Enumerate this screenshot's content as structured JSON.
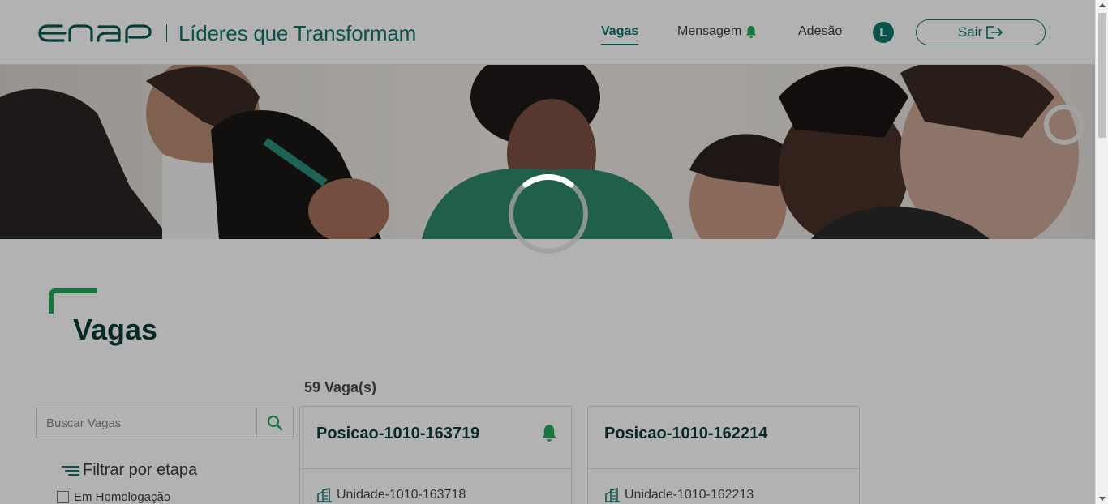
{
  "header": {
    "logo_text": "enap",
    "app_title": "Líderes que Transformam",
    "nav": {
      "vagas": "Vagas",
      "mensagem": "Mensagem",
      "adesao": "Adesão"
    },
    "avatar_initial": "L",
    "logout_label": "Sair"
  },
  "main": {
    "page_title": "Vagas",
    "vagas_count": "59 Vaga(s)",
    "search": {
      "placeholder": "Buscar Vagas",
      "value": ""
    },
    "filter": {
      "title": "Filtrar por etapa",
      "options": [
        {
          "label": "Em Homologação",
          "checked": false
        }
      ]
    },
    "cards": [
      {
        "title": "Posicao-1010-163719",
        "unit": "Unidade-1010-163718",
        "has_notification": true
      },
      {
        "title": "Posicao-1010-162214",
        "unit": "Unidade-1010-162213",
        "has_notification": false
      }
    ]
  },
  "colors": {
    "brand_teal": "#0e776d",
    "accent_green": "#1faa5a",
    "dark_title": "#0b3b3a",
    "overlay": "rgba(0,0,0,0.30)"
  },
  "icons": {
    "search": "search-icon",
    "bell": "bell-icon",
    "logout": "logout-icon",
    "filter": "filter-lines-icon",
    "building": "building-icon",
    "spinner": "loading-spinner"
  },
  "state": {
    "loading": true
  }
}
